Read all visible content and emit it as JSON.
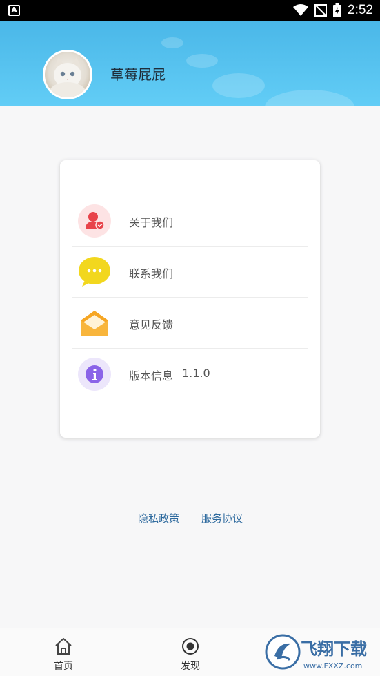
{
  "status_bar": {
    "left_icon_letter": "A",
    "time": "2:52",
    "icons": [
      "wifi-icon",
      "signal-icon",
      "battery-charging-icon"
    ]
  },
  "profile": {
    "username": "草莓屁屁",
    "avatar": "cat-avatar"
  },
  "menu": {
    "items": [
      {
        "label": "关于我们",
        "icon": "about-us-icon",
        "color": "#e8434a"
      },
      {
        "label": "联系我们",
        "icon": "chat-bubble-icon",
        "color": "#f2d71e"
      },
      {
        "label": "意见反馈",
        "icon": "envelope-icon",
        "color": "#f6a623"
      },
      {
        "label": "版本信息",
        "icon": "info-icon",
        "color": "#8a63e8",
        "value": "1.1.0"
      }
    ]
  },
  "links": {
    "privacy": "隐私政策",
    "terms": "服务协议"
  },
  "bottom_nav": {
    "items": [
      {
        "label": "首页",
        "icon": "home-icon"
      },
      {
        "label": "发现",
        "icon": "discover-icon"
      }
    ]
  },
  "watermark": {
    "text": "飞翔下载",
    "sub": "www.FXXZ.com"
  },
  "colors": {
    "header_top": "#4ab7e8",
    "header_bottom": "#62cdf6",
    "link": "#2e6a9e"
  }
}
